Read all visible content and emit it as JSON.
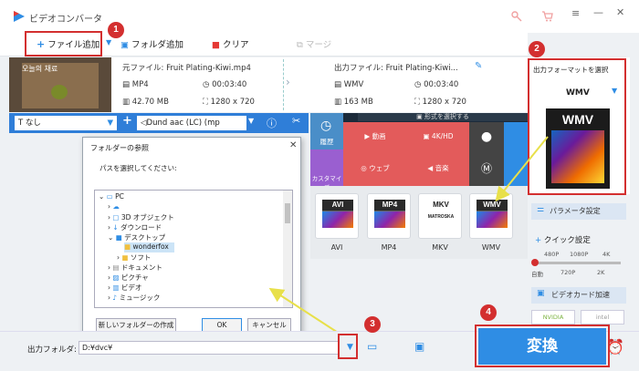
{
  "app": {
    "title": "ビデオコンバータ"
  },
  "toolbar": {
    "add_file": "ファイル追加",
    "add_folder": "フォルダ追加",
    "clear": "クリア",
    "merge": "マージ"
  },
  "file": {
    "thumb_text": "오늘의 채료",
    "source_label": "元ファイル: Fruit Plating-Kiwi.mp4",
    "source_format": "MP4",
    "source_duration": "00:03:40",
    "source_size": "42.70 MB",
    "source_resolution": "1280 x 720",
    "output_label": "出力ファイル: Fruit Plating-Kiwi...",
    "output_format": "WMV",
    "output_duration": "00:03:40",
    "output_size": "163 MB",
    "output_resolution": "1280 x 720"
  },
  "options": {
    "subtitle": "なし",
    "audio": "Dund aac (LC) (mp"
  },
  "format_panel": {
    "banner": "形式を選択する",
    "recent": "履歴",
    "video": "動画",
    "hd": "4K/HD",
    "web": "ウェブ",
    "music": "音楽",
    "custom": "カスタマイズ",
    "formats": [
      {
        "code": "AVI",
        "label": "AVI"
      },
      {
        "code": "MP4",
        "label": "MP4"
      },
      {
        "code": "MKV",
        "label": "MKV"
      },
      {
        "code": "WMV",
        "label": "WMV"
      }
    ],
    "mkv_sub": "MATROSKA"
  },
  "right_panel": {
    "title": "出力フォーマットを選択",
    "selected": "WMV",
    "param_btn": "パラメータ設定",
    "quick_label": "クイック設定",
    "res_top": [
      "480P",
      "1080P",
      "4K"
    ],
    "res_bottom": [
      "自動",
      "720P",
      "2K"
    ],
    "gpu_btn": "ビデオカード加速",
    "nvidia": "NVIDIA",
    "intel": "intel"
  },
  "dialog": {
    "title": "フォルダーの参照",
    "prompt": "パスを選択してください:",
    "tree": [
      "PC",
      "",
      "3D オブジェクト",
      "ダウンロード",
      "デスクトップ",
      "wonderfox",
      "ソフト",
      "ドキュメント",
      "ピクチャ",
      "ビデオ",
      "ミュージック"
    ],
    "new_folder": "新しいフォルダーの作成(N)",
    "ok": "OK",
    "cancel": "キャンセル"
  },
  "bottom": {
    "folder_label": "出力フォルダ:",
    "folder_value": "D:¥dvc¥",
    "convert": "変換"
  },
  "badges": [
    "1",
    "2",
    "3",
    "4"
  ],
  "colors": {
    "accent": "#2f8de4",
    "highlight": "#d32f2f",
    "arrow": "#e8e04a"
  }
}
